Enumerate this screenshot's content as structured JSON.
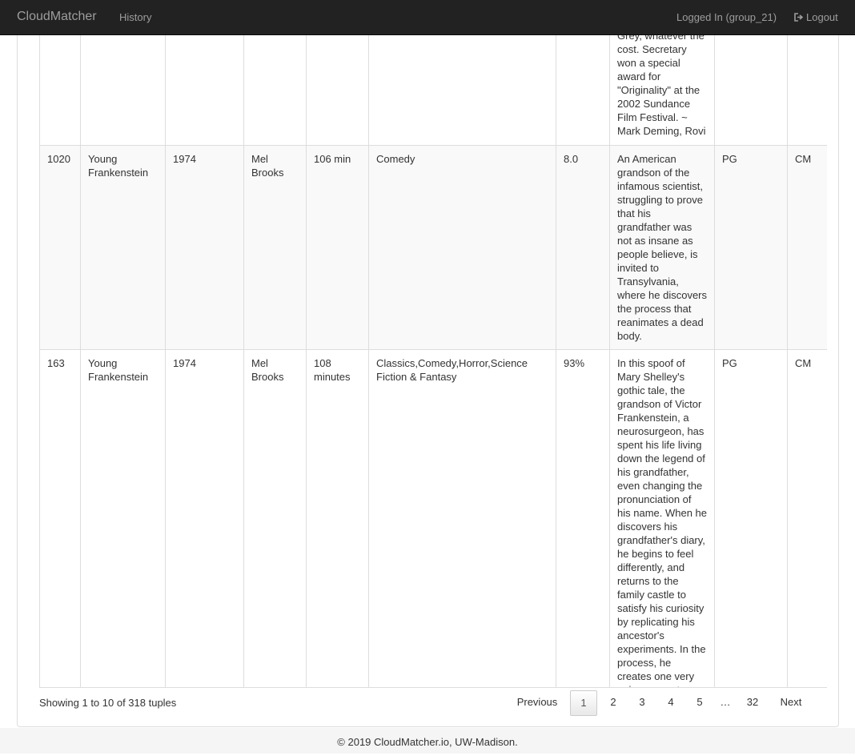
{
  "navbar": {
    "brand": "CloudMatcher",
    "history": "History",
    "user": "Logged In (group_21)",
    "logout": "Logout"
  },
  "table": {
    "rows": [
      {
        "id": "",
        "title": "",
        "year": "",
        "director": "",
        "duration": "",
        "genre": "",
        "rating": "",
        "description": "her position with Grey, whatever the cost. Secretary won a special award for \"Originality\" at the 2002 Sundance Film Festival. ~ Mark Deming, Rovi",
        "mpaa": "",
        "source": ""
      },
      {
        "id": "1020",
        "title": "Young Frankenstein",
        "year": "1974",
        "director": "Mel Brooks",
        "duration": "106 min",
        "genre": "Comedy",
        "rating": "8.0",
        "description": "An American grandson of the infamous scientist, struggling to prove that his grandfather was not as insane as people believe, is invited to Transylvania, where he discovers the process that reanimates a dead body.",
        "mpaa": "PG",
        "source": "CM"
      },
      {
        "id": "163",
        "title": "Young Frankenstein",
        "year": "1974",
        "director": "Mel Brooks",
        "duration": "108 minutes",
        "genre": "Classics,Comedy,Horror,Science Fiction & Fantasy",
        "rating": "93%",
        "description": "In this spoof of Mary Shelley's gothic tale, the grandson of Victor Frankenstein, a neurosurgeon, has spent his life living down the legend of his grandfather, even changing the pronunciation of his name. When he discovers his grandfather's diary, he begins to feel differently, and returns to the family castle to satisfy his curiosity by replicating his ancestor's experiments. In the process, he creates one very unique monster.",
        "mpaa": "PG",
        "source": "CM"
      }
    ]
  },
  "info": "Showing 1 to 10 of 318 tuples",
  "pagination": {
    "previous": "Previous",
    "pages": [
      "1",
      "2",
      "3",
      "4",
      "5",
      "…",
      "32"
    ],
    "active": "1",
    "next": "Next"
  },
  "footer": "© 2019 CloudMatcher.io, UW-Madison."
}
